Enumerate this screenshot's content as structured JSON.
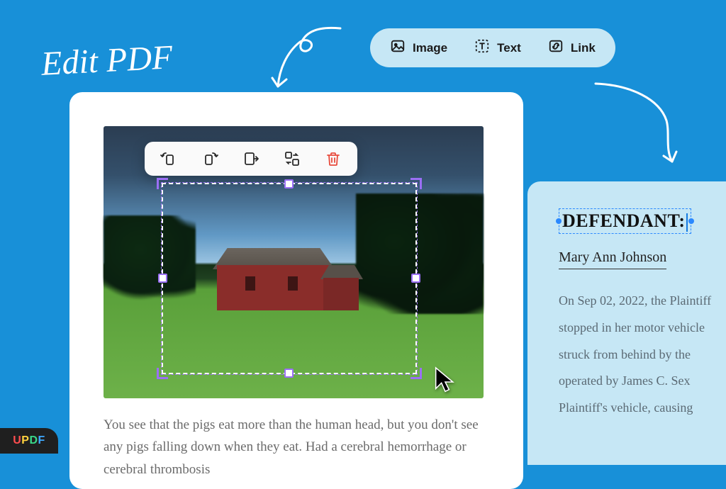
{
  "title": "Edit PDF",
  "toolbar": {
    "image": "Image",
    "text": "Text",
    "link": "Link"
  },
  "image_tools": {
    "rotate_left": "rotate-left",
    "rotate_right": "rotate-right",
    "extract": "extract",
    "replace": "replace",
    "delete": "delete"
  },
  "doc_body": "You see that the pigs eat more than the human head, but you don't see any pigs falling down when they eat. Had a cerebral hemorrhage or cerebral thrombosis",
  "panel": {
    "heading": "DEFENDANT:",
    "name": "Mary Ann Johnson",
    "paragraph": "On Sep 02, 2022, the Plaintiff stopped in her motor vehicle struck from behind by the operated by James C. Sex Plaintiff's vehicle, causing"
  },
  "logo": {
    "u": "U",
    "p": "P",
    "d": "D",
    "f": "F"
  }
}
